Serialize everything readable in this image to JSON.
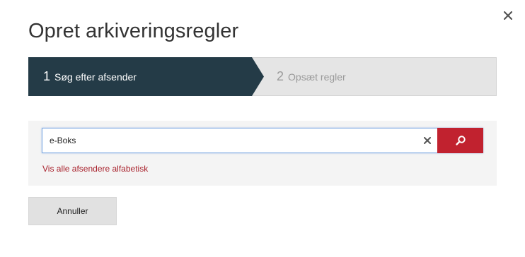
{
  "dialog": {
    "title": "Opret arkiveringsregler",
    "close_icon": "close-icon"
  },
  "steps": [
    {
      "number": "1",
      "label": "Søg efter afsender",
      "state": "active"
    },
    {
      "number": "2",
      "label": "Opsæt regler",
      "state": "inactive"
    }
  ],
  "search": {
    "value": "e-Boks",
    "clear_icon": "clear-icon",
    "search_icon": "search-icon",
    "show_all_link": "Vis alle afsendere alfabetisk"
  },
  "footer": {
    "cancel_label": "Annuller"
  },
  "colors": {
    "step_active_bg": "#243b47",
    "step_inactive_bg": "#e5e5e5",
    "accent_red": "#c1222f",
    "link_red": "#a8202b",
    "panel_bg": "#f4f4f4",
    "button_bg": "#e1e1e1"
  }
}
